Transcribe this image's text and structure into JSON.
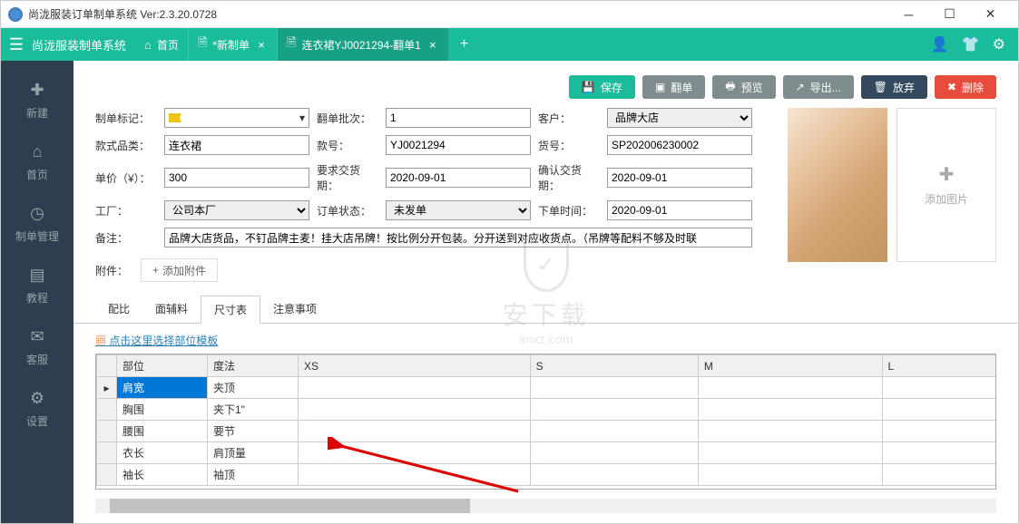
{
  "window": {
    "title": "尚泷服装订单制单系统 Ver:2.3.20.0728"
  },
  "topbar": {
    "app_name": "尚泷服装制单系统",
    "tabs": [
      {
        "icon": "⌂",
        "label": "首页"
      },
      {
        "icon": "🗎",
        "label": "*新制单"
      },
      {
        "icon": "🗎",
        "label": "连衣裙YJ0021294-翻单1"
      }
    ]
  },
  "sidebar": {
    "items": [
      {
        "icon": "✚",
        "label": "新建"
      },
      {
        "icon": "⌂",
        "label": "首页"
      },
      {
        "icon": "◷",
        "label": "制单管理"
      },
      {
        "icon": "▤",
        "label": "教程"
      },
      {
        "icon": "✉",
        "label": "客服"
      },
      {
        "icon": "⚙",
        "label": "设置"
      }
    ]
  },
  "actions": {
    "save": "保存",
    "duplicate": "翻单",
    "preview": "预览",
    "export": "导出...",
    "discard": "放弃",
    "delete": "删除"
  },
  "form": {
    "labels": {
      "flag": "制单标记：",
      "batch": "翻单批次：",
      "customer": "客户：",
      "category": "款式品类：",
      "style_no": "款号：",
      "sku": "货号：",
      "price": "单价（¥）：",
      "require_date": "要求交货期：",
      "confirm_date": "确认交货期：",
      "factory": "工厂：",
      "status": "订单状态：",
      "order_time": "下单时间：",
      "remark": "备注：",
      "attach": "附件："
    },
    "values": {
      "batch": "1",
      "customer": "品牌大店",
      "category": "连衣裙",
      "style_no": "YJ0021294",
      "sku": "SP202006230002",
      "price": "300",
      "require_date": "2020-09-01",
      "confirm_date": "2020-09-01",
      "factory": "公司本厂",
      "status": "未发单",
      "order_time": "2020-09-01",
      "remark": "品牌大店货品，不钉品牌主麦！挂大店吊牌！按比例分开包装。分开送到对应收货点。（吊牌等配料不够及时联"
    },
    "add_attach": "添加附件",
    "add_image": "添加图片"
  },
  "subtabs": {
    "items": [
      "配比",
      "面辅料",
      "尺寸表",
      "注意事项"
    ],
    "active": 2
  },
  "template_link": "点击这里选择部位模板",
  "table": {
    "headers": [
      "",
      "部位",
      "度法",
      "XS",
      "S",
      "M",
      "L"
    ],
    "rows": [
      {
        "indicator": "▸",
        "part": "肩宽",
        "method": "夹顶",
        "selected": true
      },
      {
        "indicator": "",
        "part": "胸围",
        "method": "夹下1\""
      },
      {
        "indicator": "",
        "part": "腰围",
        "method": "要节"
      },
      {
        "indicator": "",
        "part": "衣长",
        "method": "肩顶量"
      },
      {
        "indicator": "",
        "part": "袖长",
        "method": "袖顶"
      }
    ]
  },
  "watermark": {
    "text": "安下载",
    "url": "anxz.com"
  }
}
